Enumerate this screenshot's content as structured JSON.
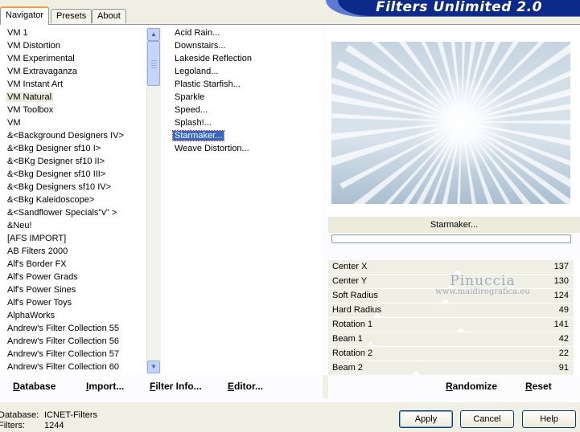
{
  "banner": {
    "title": "Filters Unlimited 2.0"
  },
  "tabs": [
    {
      "label": "Navigator",
      "active": true
    },
    {
      "label": "Presets",
      "active": false
    },
    {
      "label": "About",
      "active": false
    }
  ],
  "categories": [
    "VM 1",
    "VM Distortion",
    "VM Experimental",
    "VM Extravaganza",
    "VM Instant Art",
    "VM Natural",
    "VM Toolbox",
    "VM",
    "&<Background Designers IV>",
    "&<Bkg Designer sf10 I>",
    "&<BKg Designer sf10 II>",
    "&<Bkg Designer sf10 III>",
    "&<Bkg Designers sf10 IV>",
    "&<Bkg Kaleidoscope>",
    "&<Sandflower Specials\"v\" >",
    "&Neu!",
    "[AFS IMPORT]",
    "AB Filters 2000",
    "Alf's Border FX",
    "Alf's Power Grads",
    "Alf's Power Sines",
    "Alf's Power Toys",
    "AlphaWorks",
    "Andrew's Filter Collection 55",
    "Andrew's Filter Collection 56",
    "Andrew's Filter Collection 57",
    "Andrew's Filter Collection 60"
  ],
  "selected_category": "VM Natural",
  "filters": [
    "Acid Rain...",
    "Downstairs...",
    "Lakeside Reflection",
    "Legoland...",
    "Plastic Starfish...",
    "Sparkle",
    "Speed...",
    "Splash!...",
    "Starmaker...",
    "Weave Distortion..."
  ],
  "selected_filter": "Starmaker...",
  "preview": {
    "filter_label": "Starmaker...",
    "progress": 0
  },
  "params": [
    {
      "name": "Center X",
      "value": "137",
      "level": 0.537
    },
    {
      "name": "Center Y",
      "value": "130",
      "level": 0.51
    },
    {
      "name": "Soft Radius",
      "value": "124",
      "level": 0.486
    },
    {
      "name": "Hard Radius",
      "value": "49",
      "level": 0.192
    },
    {
      "name": "Rotation 1",
      "value": "141",
      "level": 0.553
    },
    {
      "name": "Beam 1",
      "value": "42",
      "level": 0.165
    },
    {
      "name": "Rotation 2",
      "value": "22",
      "level": 0.086
    },
    {
      "name": "Beam 2",
      "value": "91",
      "level": 0.357
    }
  ],
  "watermark": {
    "name": "Pinuccia",
    "url": "www.maidiregrafica.eu"
  },
  "links": {
    "database": "Database",
    "import": "Import...",
    "filter_info": "Filter Info...",
    "editor": "Editor...",
    "randomize": "Randomize",
    "reset": "Reset"
  },
  "status": {
    "database_label": "Database:",
    "database_value": "ICNET-Filters",
    "filters_label": "Filters:",
    "filters_value": "1244"
  },
  "buttons": {
    "apply": "Apply",
    "cancel": "Cancel",
    "help": "Help"
  },
  "colors": {
    "banner": "#0b2a8a",
    "selection": "#316ac5",
    "panel": "#f0efe4"
  }
}
